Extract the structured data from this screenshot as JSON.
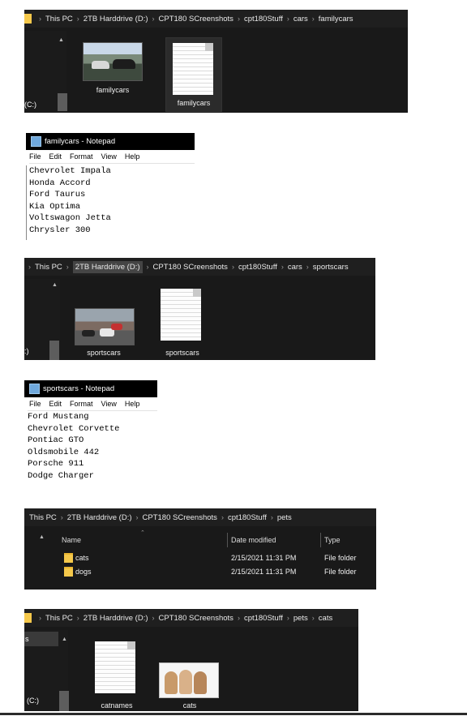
{
  "window1": {
    "breadcrumb": [
      "This PC",
      "2TB Harddrive (D:)",
      "CPT180 SCreenshots",
      "cpt180Stuff",
      "cars",
      "familycars"
    ],
    "nav_label": "(C:)",
    "items": [
      {
        "label": "familycars",
        "kind": "image"
      },
      {
        "label": "familycars",
        "kind": "text"
      }
    ]
  },
  "notepad1": {
    "title": "familycars - Notepad",
    "menu": [
      "File",
      "Edit",
      "Format",
      "View",
      "Help"
    ],
    "lines": [
      "Chevrolet Impala",
      "Honda Accord",
      "Ford Taurus",
      "Kia Optima",
      "Voltswagon Jetta",
      "Chrysler 300"
    ]
  },
  "window2": {
    "breadcrumb": [
      "This PC",
      "2TB Harddrive (D:)",
      "CPT180 SCreenshots",
      "cpt180Stuff",
      "cars",
      "sportscars"
    ],
    "nav_label": ":)",
    "items": [
      {
        "label": "sportscars",
        "kind": "image"
      },
      {
        "label": "sportscars",
        "kind": "text"
      }
    ]
  },
  "notepad2": {
    "title": "sportscars - Notepad",
    "menu": [
      "File",
      "Edit",
      "Format",
      "View",
      "Help"
    ],
    "lines": [
      "Ford Mustang",
      "Chevrolet Corvette",
      "Pontiac GTO",
      "Oldsmobile 442",
      "Porsche 911",
      "Dodge Charger"
    ]
  },
  "window3": {
    "breadcrumb": [
      "This PC",
      "2TB Harddrive (D:)",
      "CPT180 SCreenshots",
      "cpt180Stuff",
      "pets"
    ],
    "columns": [
      "Name",
      "Date modified",
      "Type"
    ],
    "rows": [
      {
        "name": "cats",
        "date": "2/15/2021 11:31 PM",
        "type": "File folder"
      },
      {
        "name": "dogs",
        "date": "2/15/2021 11:31 PM",
        "type": "File folder"
      }
    ]
  },
  "window4": {
    "breadcrumb": [
      "This PC",
      "2TB Harddrive (D:)",
      "CPT180 SCreenshots",
      "cpt180Stuff",
      "pets",
      "cats"
    ],
    "nav_label_top": "s",
    "nav_label": "(C:)",
    "items": [
      {
        "label": "catnames",
        "kind": "text"
      },
      {
        "label": "cats",
        "kind": "image"
      }
    ]
  },
  "icons": [
    "folder-icon",
    "notepad-icon",
    "chevron-right-icon",
    "scroll-up-icon",
    "sort-up-icon"
  ]
}
